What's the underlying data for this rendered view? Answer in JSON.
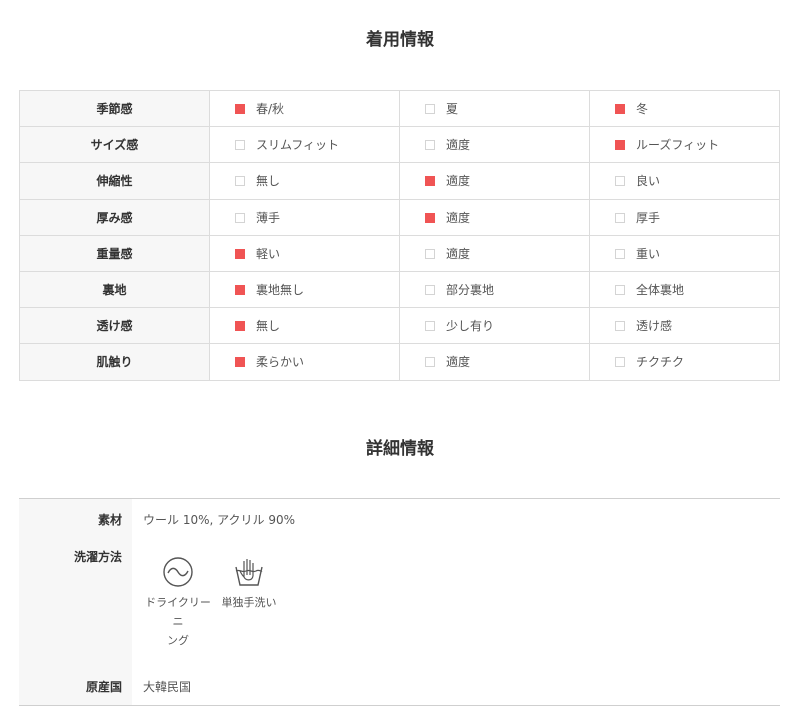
{
  "wear_info": {
    "title": "着用情報",
    "rows": [
      {
        "label": "季節感",
        "options": [
          {
            "text": "春/秋",
            "checked": true
          },
          {
            "text": "夏",
            "checked": false
          },
          {
            "text": "冬",
            "checked": true
          }
        ]
      },
      {
        "label": "サイズ感",
        "options": [
          {
            "text": "スリムフィット",
            "checked": false
          },
          {
            "text": "適度",
            "checked": false
          },
          {
            "text": "ルーズフィット",
            "checked": true
          }
        ]
      },
      {
        "label": "伸縮性",
        "options": [
          {
            "text": "無し",
            "checked": false
          },
          {
            "text": "適度",
            "checked": true
          },
          {
            "text": "良い",
            "checked": false
          }
        ]
      },
      {
        "label": "厚み感",
        "options": [
          {
            "text": "薄手",
            "checked": false
          },
          {
            "text": "適度",
            "checked": true
          },
          {
            "text": "厚手",
            "checked": false
          }
        ]
      },
      {
        "label": "重量感",
        "options": [
          {
            "text": "軽い",
            "checked": true
          },
          {
            "text": "適度",
            "checked": false
          },
          {
            "text": "重い",
            "checked": false
          }
        ]
      },
      {
        "label": "裏地",
        "options": [
          {
            "text": "裏地無し",
            "checked": true
          },
          {
            "text": "部分裏地",
            "checked": false
          },
          {
            "text": "全体裏地",
            "checked": false
          }
        ]
      },
      {
        "label": "透け感",
        "options": [
          {
            "text": "無し",
            "checked": true
          },
          {
            "text": "少し有り",
            "checked": false
          },
          {
            "text": "透け感",
            "checked": false
          }
        ]
      },
      {
        "label": "肌触り",
        "options": [
          {
            "text": "柔らかい",
            "checked": true
          },
          {
            "text": "適度",
            "checked": false
          },
          {
            "text": "チクチク",
            "checked": false
          }
        ]
      }
    ]
  },
  "detail_info": {
    "title": "詳細情報",
    "material_label": "素材",
    "material_value": "ウール 10%, アクリル 90%",
    "washing_label": "洗濯方法",
    "care": [
      {
        "icon": "dry-clean-icon",
        "line1": "ドライクリーニ",
        "line2": "ング"
      },
      {
        "icon": "hand-wash-icon",
        "line1": "単独手洗い",
        "line2": ""
      }
    ],
    "origin_label": "原産国",
    "origin_value": "大韓民国"
  },
  "colors": {
    "checked": "#f05454",
    "unchecked_border": "#d4d4d4",
    "label_bg": "#f7f7f7"
  }
}
